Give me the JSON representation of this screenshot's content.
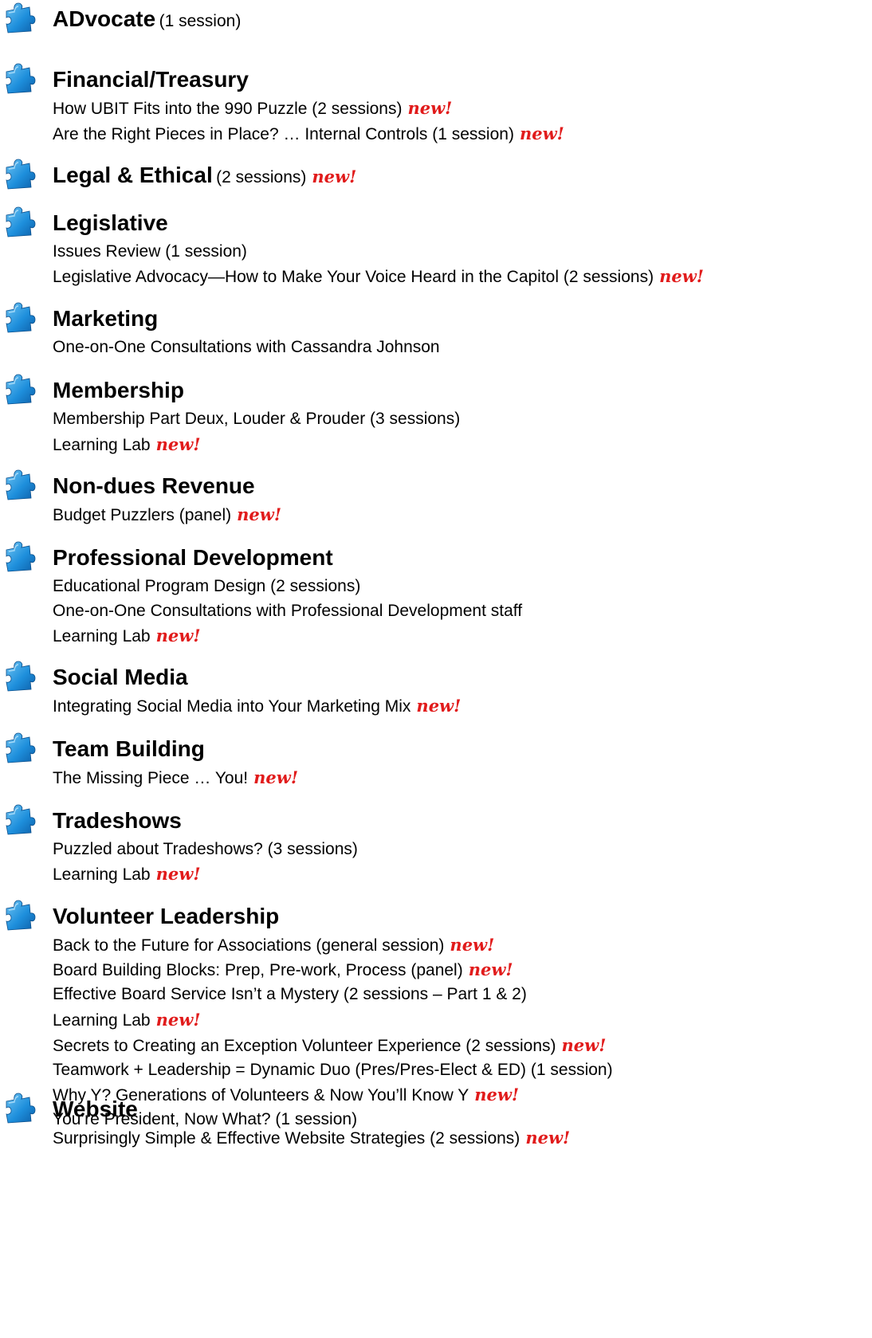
{
  "badge": {
    "text": "new!",
    "color": "#e11b1b"
  },
  "icon_color": "#1e8fdc",
  "sections": [
    {
      "title": "ADvocate",
      "suffix": "(1 session)",
      "items": []
    },
    {
      "title": "Financial/Treasury",
      "items": [
        {
          "text": "How UBIT Fits into the 990 Puzzle (2 sessions)",
          "new": true
        },
        {
          "text": "Are the Right Pieces in Place? … Internal Controls (1 session)",
          "new": true
        }
      ]
    },
    {
      "title": "Legal & Ethical",
      "suffix": "(2 sessions)",
      "new": true,
      "items": []
    },
    {
      "title": "Legislative",
      "items": [
        {
          "text": "Issues Review (1 session)",
          "new": false
        },
        {
          "text": "Legislative Advocacy—How to Make Your Voice Heard in the Capitol (2 sessions)",
          "new": true
        }
      ]
    },
    {
      "title": "Marketing",
      "items": [
        {
          "text": "One-on-One Consultations with Cassandra Johnson",
          "new": false
        }
      ]
    },
    {
      "title": "Membership",
      "items": [
        {
          "text": "Membership Part Deux, Louder & Prouder (3 sessions)",
          "new": false
        },
        {
          "text": "Learning Lab",
          "new": true
        }
      ]
    },
    {
      "title": "Non-dues Revenue",
      "items": [
        {
          "text": "Budget Puzzlers (panel)",
          "new": true
        }
      ]
    },
    {
      "title": "Professional Development",
      "items": [
        {
          "text": "Educational Program Design (2 sessions)",
          "new": false
        },
        {
          "text": "One-on-One Consultations with Professional Development staff",
          "new": false
        },
        {
          "text": "Learning Lab",
          "new": true
        }
      ]
    },
    {
      "title": "Social Media",
      "items": [
        {
          "text": "Integrating Social Media into Your Marketing Mix",
          "new": true
        }
      ]
    },
    {
      "title": "Team Building",
      "items": [
        {
          "text": "The Missing Piece … You!",
          "new": true
        }
      ]
    },
    {
      "title": "Tradeshows",
      "items": [
        {
          "text": "Puzzled about Tradeshows? (3 sessions)",
          "new": false
        },
        {
          "text": "Learning Lab",
          "new": true
        }
      ]
    },
    {
      "title": "Volunteer Leadership",
      "items": [
        {
          "text": "Back to the Future for Associations (general session)",
          "new": true
        },
        {
          "text": "Board Building Blocks: Prep, Pre-work, Process (panel)",
          "new": true
        },
        {
          "text": "Effective Board Service Isn’t a Mystery (2 sessions – Part 1 & 2)",
          "new": false
        },
        {
          "text": "Learning Lab",
          "new": true
        },
        {
          "text": "Secrets to Creating an Exception Volunteer Experience (2 sessions)",
          "new": true
        },
        {
          "text": "Teamwork + Leadership = Dynamic Duo (Pres/Pres-Elect & ED) (1 session)",
          "new": false
        },
        {
          "text": "Why Y? Generations of Volunteers & Now You’ll Know Y",
          "new": true
        },
        {
          "text": "You’re President, Now What? (1 session)",
          "new": false
        }
      ]
    },
    {
      "title": "Website",
      "items": [
        {
          "text": "Surprisingly Simple & Effective Website Strategies (2 sessions)",
          "new": true
        }
      ]
    }
  ]
}
